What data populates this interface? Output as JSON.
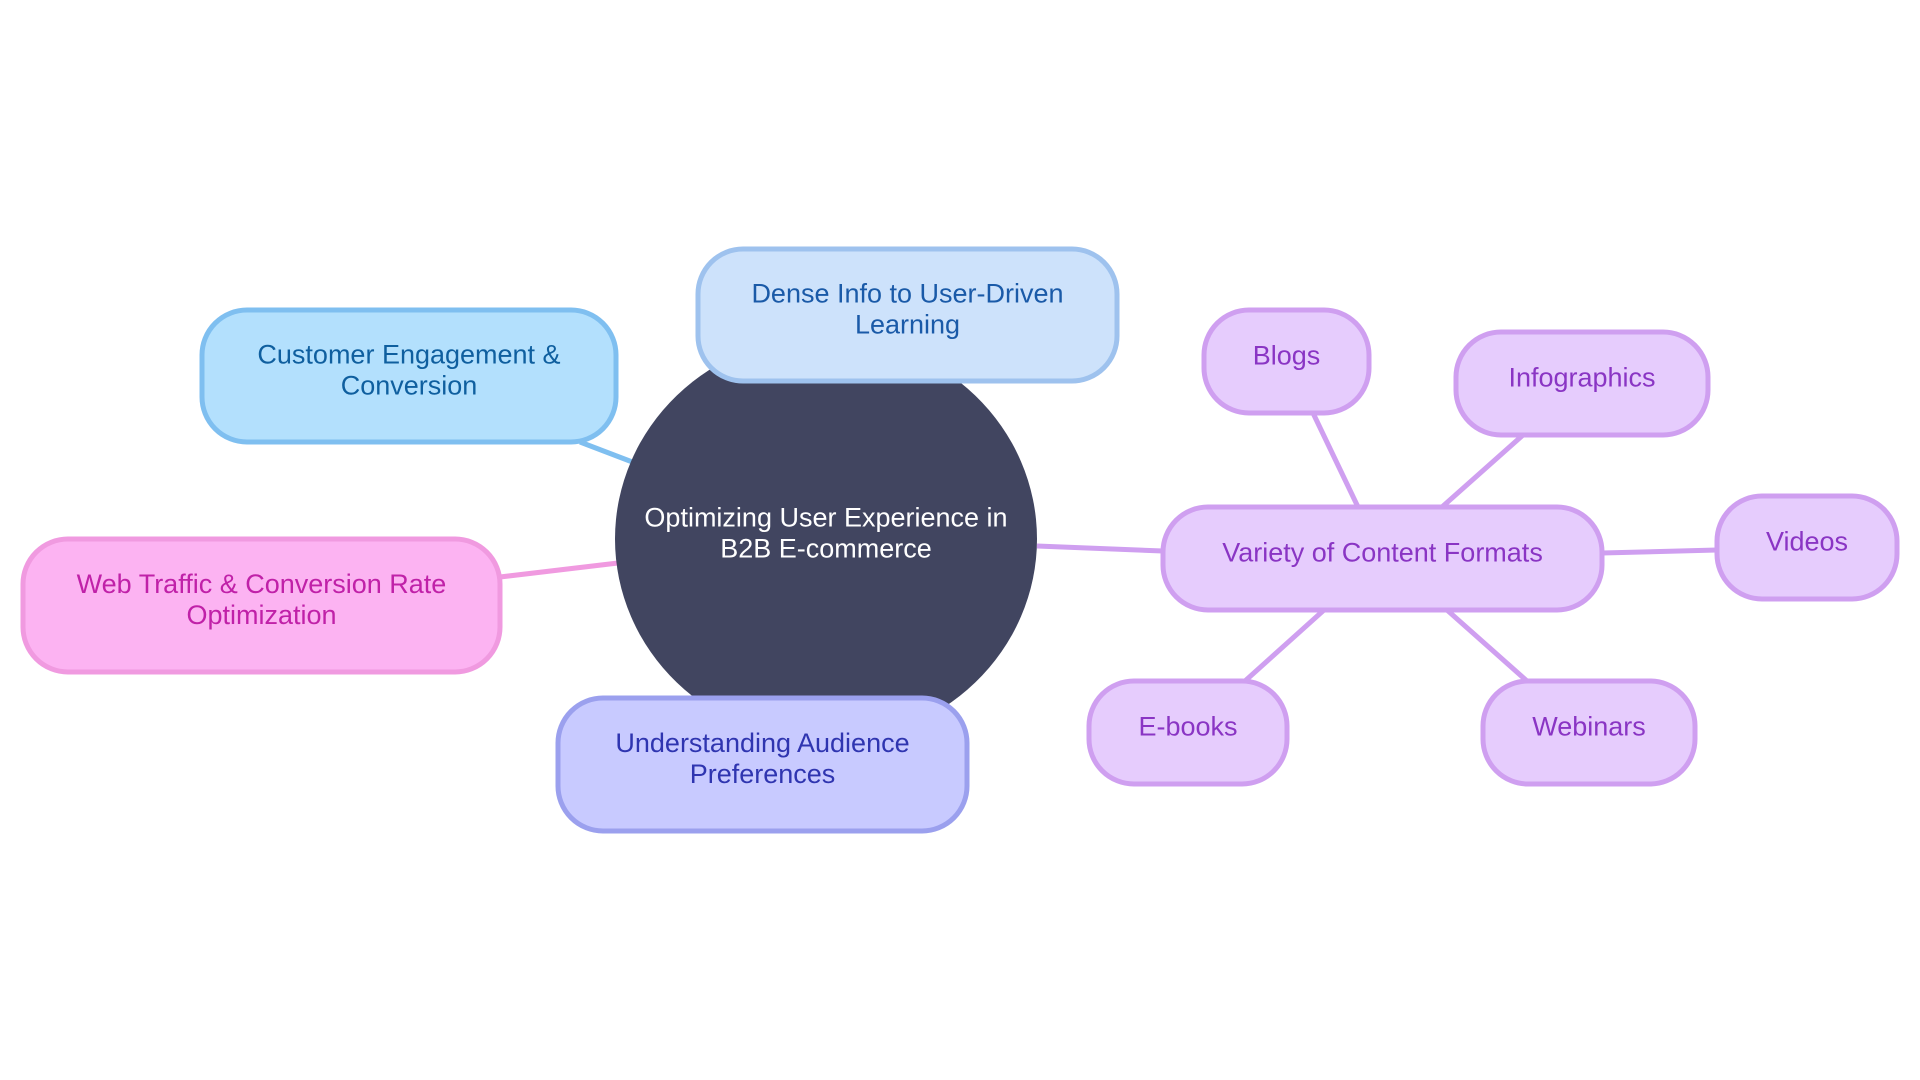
{
  "diagram": {
    "type": "mindmap",
    "root": {
      "id": "root",
      "lines": [
        "Optimizing User Experience in",
        "B2B E-commerce"
      ],
      "fill": "#414560",
      "stroke": "#414560",
      "text_color": "#ffffff"
    },
    "branches": [
      {
        "id": "customer-engagement",
        "lines": [
          "Customer Engagement &",
          "Conversion"
        ],
        "fill": "#b3e0fd",
        "stroke": "#7fbff0",
        "text_color": "#0f5f9f",
        "parent": "root"
      },
      {
        "id": "dense-info",
        "lines": [
          "Dense Info to User-Driven",
          "Learning"
        ],
        "fill": "#cde2fb",
        "stroke": "#9ec2ee",
        "text_color": "#1a5aa8",
        "parent": "root"
      },
      {
        "id": "web-traffic",
        "lines": [
          "Web Traffic & Conversion Rate",
          "Optimization"
        ],
        "fill": "#fcb3f2",
        "stroke": "#f09ae0",
        "text_color": "#c021a8",
        "parent": "root"
      },
      {
        "id": "understanding-audience",
        "lines": [
          "Understanding Audience",
          "Preferences"
        ],
        "fill": "#c8caff",
        "stroke": "#9ba0ee",
        "text_color": "#2f35b0",
        "parent": "root"
      },
      {
        "id": "variety-content",
        "lines": [
          "Variety of Content Formats"
        ],
        "fill": "#e6ccfd",
        "stroke": "#cf9ff0",
        "text_color": "#8a35c4",
        "parent": "root"
      }
    ],
    "leaves": [
      {
        "id": "blogs",
        "lines": [
          "Blogs"
        ],
        "parent": "variety-content"
      },
      {
        "id": "infographics",
        "lines": [
          "Infographics"
        ],
        "parent": "variety-content"
      },
      {
        "id": "videos",
        "lines": [
          "Videos"
        ],
        "parent": "variety-content"
      },
      {
        "id": "e-books",
        "lines": [
          "E-books"
        ],
        "parent": "variety-content"
      },
      {
        "id": "webinars",
        "lines": [
          "Webinars"
        ],
        "parent": "variety-content"
      }
    ],
    "leaf_style": {
      "fill": "#e6ccfd",
      "stroke": "#cf9ff0",
      "text_color": "#8a35c4",
      "edge_color": "#cf9ff0"
    }
  }
}
